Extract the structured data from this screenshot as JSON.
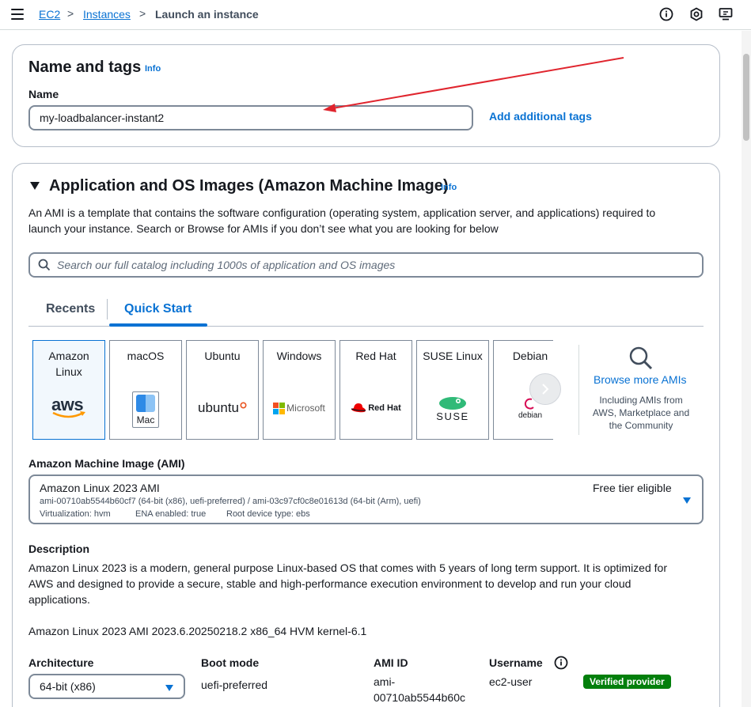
{
  "breadcrumb": {
    "root": "EC2",
    "parent": "Instances",
    "current": "Launch an instance",
    "separator": ">"
  },
  "name_tags": {
    "title": "Name and tags",
    "info": "Info",
    "name_label": "Name",
    "name_value": "my-loadbalancer-instant2",
    "add_tags": "Add additional tags"
  },
  "ami_section": {
    "title": "Application and OS Images (Amazon Machine Image)",
    "info": "Info",
    "description_line1": "An AMI is a template that contains the software configuration (operating system, application server, and applications) required to",
    "description_line2": "launch your instance. Search or Browse for AMIs if you don’t see what you are looking for below",
    "search_placeholder": "Search our full catalog including 1000s of application and OS images",
    "tabs": [
      "Recents",
      "Quick Start"
    ],
    "active_tab": "Quick Start",
    "tiles": [
      {
        "name_line1": "Amazon",
        "name_line2": "Linux",
        "logo": "aws"
      },
      {
        "name_line1": "macOS",
        "logo": "Mac"
      },
      {
        "name_line1": "Ubuntu",
        "logo": "ubuntu"
      },
      {
        "name_line1": "Windows",
        "logo": "Microsoft"
      },
      {
        "name_line1": "Red Hat",
        "logo": "Red Hat"
      },
      {
        "name_line1": "SUSE Linux",
        "logo": "SUSE"
      },
      {
        "name_line1": "Debian",
        "logo": "debian"
      }
    ],
    "browse": {
      "title": "Browse more AMIs",
      "sub1": "Including AMIs from",
      "sub2": "AWS, Marketplace and",
      "sub3": "the Community"
    },
    "ami_label": "Amazon Machine Image (AMI)",
    "ami_name": "Amazon Linux 2023 AMI",
    "ami_ids": "ami-00710ab5544b60cf7 (64-bit (x86), uefi-preferred) / ami-03c97cf0c8e01613d (64-bit (Arm), uefi)",
    "ami_virt": "Virtualization: hvm",
    "ami_ena": "ENA enabled: true",
    "ami_root": "Root device type: ebs",
    "free_tier": "Free tier eligible",
    "desc_label": "Description",
    "desc_line1": "Amazon Linux 2023 is a modern, general purpose Linux-based OS that comes with 5 years of long term support. It is optimized for",
    "desc_line2": "AWS and designed to provide a secure, stable and high-performance execution environment to develop and run your cloud",
    "desc_line3": "applications.",
    "ami_full": "Amazon Linux 2023 AMI 2023.6.20250218.2 x86_64 HVM kernel-6.1",
    "arch_label": "Architecture",
    "arch_value": "64-bit (x86)",
    "boot_label": "Boot mode",
    "boot_value": "uefi-preferred",
    "amiid_label": "AMI ID",
    "amiid_line1": "ami-",
    "amiid_line2": "00710ab5544b60c",
    "user_label": "Username",
    "user_value": "ec2-user",
    "verified": "Verified provider"
  },
  "colors": {
    "link": "#0972d3",
    "verified": "#037f0c",
    "annotation_arrow": "#e0252e"
  }
}
